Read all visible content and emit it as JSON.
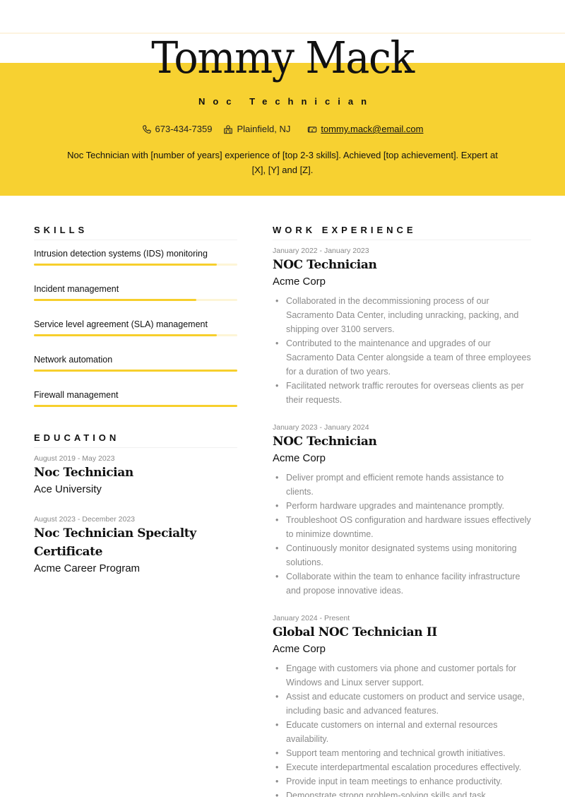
{
  "header": {
    "name": "Tommy Mack",
    "title": "Noc Technician",
    "contacts": {
      "phone": {
        "icon": "phone-icon",
        "value": "673-434-7359"
      },
      "location": {
        "icon": "location-icon",
        "value": "Plainfield, NJ"
      },
      "email": {
        "icon": "mailbox-icon",
        "value": "tommy.mack@email.com"
      }
    },
    "summary": "Noc Technician with [number of years] experience of [top 2-3 skills]. Achieved [top achievement]. Expert at [X], [Y] and [Z]."
  },
  "colors": {
    "accent": "#f7d131",
    "bar_fill": "#f7cf2c",
    "bar_track": "#fdf5d6"
  },
  "skills": {
    "heading": "SKILLS",
    "items": [
      {
        "name": "Intrusion detection systems (IDS) monitoring",
        "level": 0.9
      },
      {
        "name": "Incident management",
        "level": 0.8
      },
      {
        "name": "Service level agreement (SLA) management",
        "level": 0.9
      },
      {
        "name": "Network automation",
        "level": 1.0
      },
      {
        "name": "Firewall management",
        "level": 1.0
      }
    ]
  },
  "education": {
    "heading": "EDUCATION",
    "items": [
      {
        "dates": "August 2019 - May 2023",
        "degree": "Noc Technician",
        "school": "Ace University"
      },
      {
        "dates": "August 2023 - December 2023",
        "degree": "Noc Technician Specialty Certificate",
        "school": "Acme Career Program"
      }
    ]
  },
  "experience": {
    "heading": "WORK EXPERIENCE",
    "items": [
      {
        "dates": "January 2022 - January 2023",
        "role": "NOC Technician",
        "company": "Acme Corp",
        "bullets": [
          "Collaborated in the decommissioning process of our Sacramento Data Center, including unracking, packing, and shipping over 3100 servers.",
          "Contributed to the maintenance and upgrades of our Sacramento Data Center alongside a team of three employees for a duration of two years.",
          "Facilitated network traffic reroutes for overseas clients as per their requests."
        ]
      },
      {
        "dates": "January 2023 - January 2024",
        "role": "NOC Technician",
        "company": "Acme Corp",
        "bullets": [
          "Deliver prompt and efficient remote hands assistance to clients.",
          "Perform hardware upgrades and maintenance promptly.",
          "Troubleshoot OS configuration and hardware issues effectively to minimize downtime.",
          "Continuously monitor designated systems using monitoring solutions.",
          "Collaborate within the team to enhance facility infrastructure and propose innovative ideas."
        ]
      },
      {
        "dates": "January 2024 - Present",
        "role": "Global NOC Technician II",
        "company": "Acme Corp",
        "bullets": [
          "Engage with customers via phone and customer portals for Windows and Linux server support.",
          "Assist and educate customers on product and service usage, including basic and advanced features.",
          "Educate customers on internal and external resources availability.",
          "Support team mentoring and technical growth initiatives.",
          "Execute interdepartmental escalation procedures effectively.",
          "Provide input in team meetings to enhance productivity.",
          "Demonstrate strong problem-solving skills and task"
        ]
      }
    ]
  }
}
